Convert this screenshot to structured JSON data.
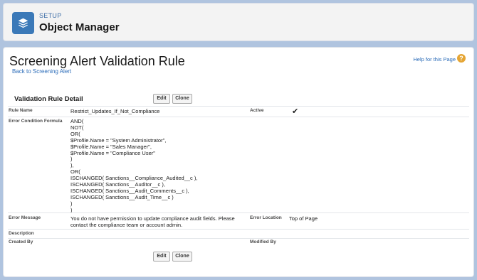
{
  "header": {
    "setup_label": "SETUP",
    "title": "Object Manager",
    "icon": "layers-icon",
    "icon_color": "#3b79b8"
  },
  "page": {
    "title": "Screening Alert Validation Rule",
    "back_link": "Back to Screening Alert",
    "help_link": "Help for this Page",
    "help_icon": "question-icon"
  },
  "section": {
    "title": "Validation Rule Detail",
    "edit_label": "Edit",
    "clone_label": "Clone"
  },
  "fields": {
    "rule_name_label": "Rule Name",
    "rule_name_value": "Restrict_Updates_If_Not_Compliance",
    "active_label": "Active",
    "active_value": "✔",
    "formula_label": "Error Condition Formula",
    "formula_lines": [
      "AND(",
      "NOT(",
      "OR(",
      "$Profile.Name = \"System Administrator\",",
      "$Profile.Name = \"Sales Manager\",",
      "$Profile.Name = \"Compliance User\"",
      ")",
      "),",
      "OR(",
      "ISCHANGED( Sanctions__Compliance_Audited__c ),",
      "ISCHANGED( Sanctions__Auditor__c ),",
      "ISCHANGED( Sanctions__Audit_Comments__c ),",
      "ISCHANGED( Sanctions__Audit_Time__c )",
      ")",
      ")"
    ],
    "error_message_label": "Error Message",
    "error_message_value": "You do not have permission to update compliance audit fields. Please contact the compliance team or account admin.",
    "error_location_label": "Error Location",
    "error_location_value": "Top of Page",
    "description_label": "Description",
    "created_by_label": "Created By",
    "modified_by_label": "Modified By"
  },
  "footer": {
    "edit_label": "Edit",
    "clone_label": "Clone"
  }
}
